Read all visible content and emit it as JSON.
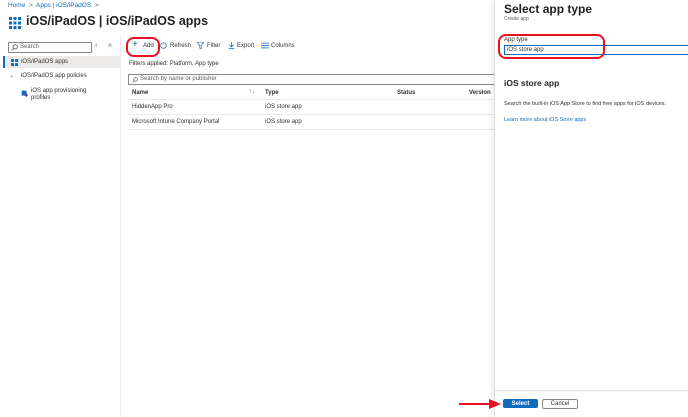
{
  "breadcrumb": [
    "Home",
    "Apps | iOS/iPadOS",
    ""
  ],
  "page": {
    "title": "iOS/iPadOS | iOS/iPadOS apps",
    "more": "···"
  },
  "sidebar": {
    "search_placeholder": "Search",
    "items": [
      {
        "label": "iOS/iPadOS apps",
        "icon": "grid-icon",
        "selected": true
      },
      {
        "label": "iOS/iPadOS app policies",
        "icon": "chevron-down-icon"
      },
      {
        "label": "iOS app provisioning profiles",
        "icon": "profile-icon"
      }
    ]
  },
  "toolbar": {
    "add": "Add",
    "refresh": "Refresh",
    "filter": "Filter",
    "export": "Export",
    "columns": "Columns"
  },
  "filters_text": "Filters applied: Platform, App type",
  "search": {
    "placeholder": "Search by name or publisher"
  },
  "table": {
    "headers": [
      "Name",
      "Type",
      "Status",
      "Version"
    ],
    "rows": [
      {
        "name": "HiddenApp Pro",
        "type": "iOS store app",
        "status": "",
        "version": ""
      },
      {
        "name": "Microsoft Intune Company Portal",
        "type": "iOS store app",
        "status": "",
        "version": ""
      }
    ]
  },
  "panel": {
    "title": "Select app type",
    "subtitle": "Create app",
    "field_label": "App type",
    "field_value": "iOS store app",
    "section_title": "iOS store app",
    "description": "Search the built-in iOS App Store to find free apps for iOS devices.",
    "learn_more": "Learn more about iOS Store apps",
    "select_button": "Select",
    "cancel_button": "Cancel"
  },
  "colors": {
    "accent": "#0f6cbd",
    "highlight": "#e81123"
  }
}
